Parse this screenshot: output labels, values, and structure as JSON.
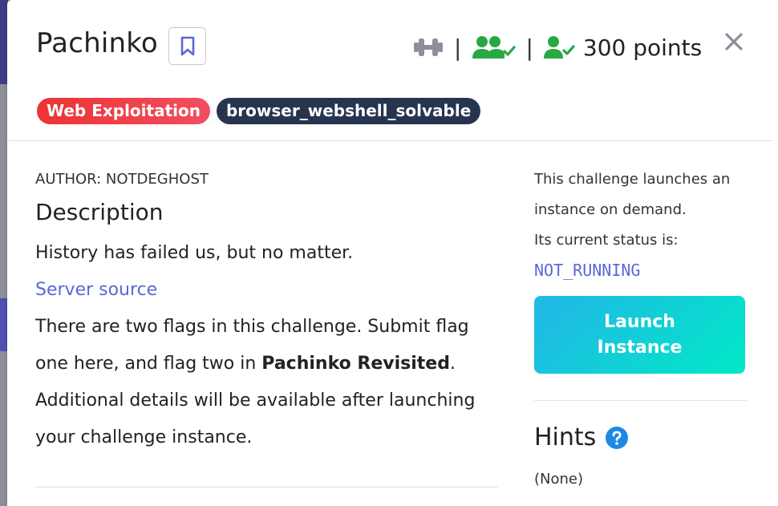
{
  "challenge": {
    "title": "Pachinko",
    "points_label": "300 points",
    "close_symbol": "✕"
  },
  "tags": [
    {
      "label": "Web Exploitation",
      "color": "#ee3333"
    },
    {
      "label": "browser_webshell_solvable",
      "color": "#27344f"
    }
  ],
  "details": {
    "author": "AUTHOR: NOTDEGHOST",
    "description_heading": "Description",
    "paragraph1": "History has failed us, but no matter.",
    "server_source_link": "Server source",
    "paragraph2_before": "There are two flags in this challenge. Submit flag one here, and flag two in ",
    "paragraph2_bold": "Pachinko Revisited",
    "paragraph2_after": ". Additional details will be available after launching your challenge instance."
  },
  "instance": {
    "line1": "This challenge launches an",
    "line2": "instance on demand.",
    "line3": "Its current status is:",
    "status": "NOT_RUNNING",
    "launch_button": "Launch Instance"
  },
  "hints": {
    "heading": "Hints",
    "value": "(None)"
  },
  "icons": {
    "difficulty": "dumbbell-icon",
    "solvers": "users-check-icon",
    "solved": "user-check-icon",
    "bookmark": "bookmark-icon",
    "help": "question-circle-icon"
  },
  "colors": {
    "accent_link": "#5a68d6",
    "success_green": "#28a745",
    "icon_gray": "#8a8f98"
  }
}
